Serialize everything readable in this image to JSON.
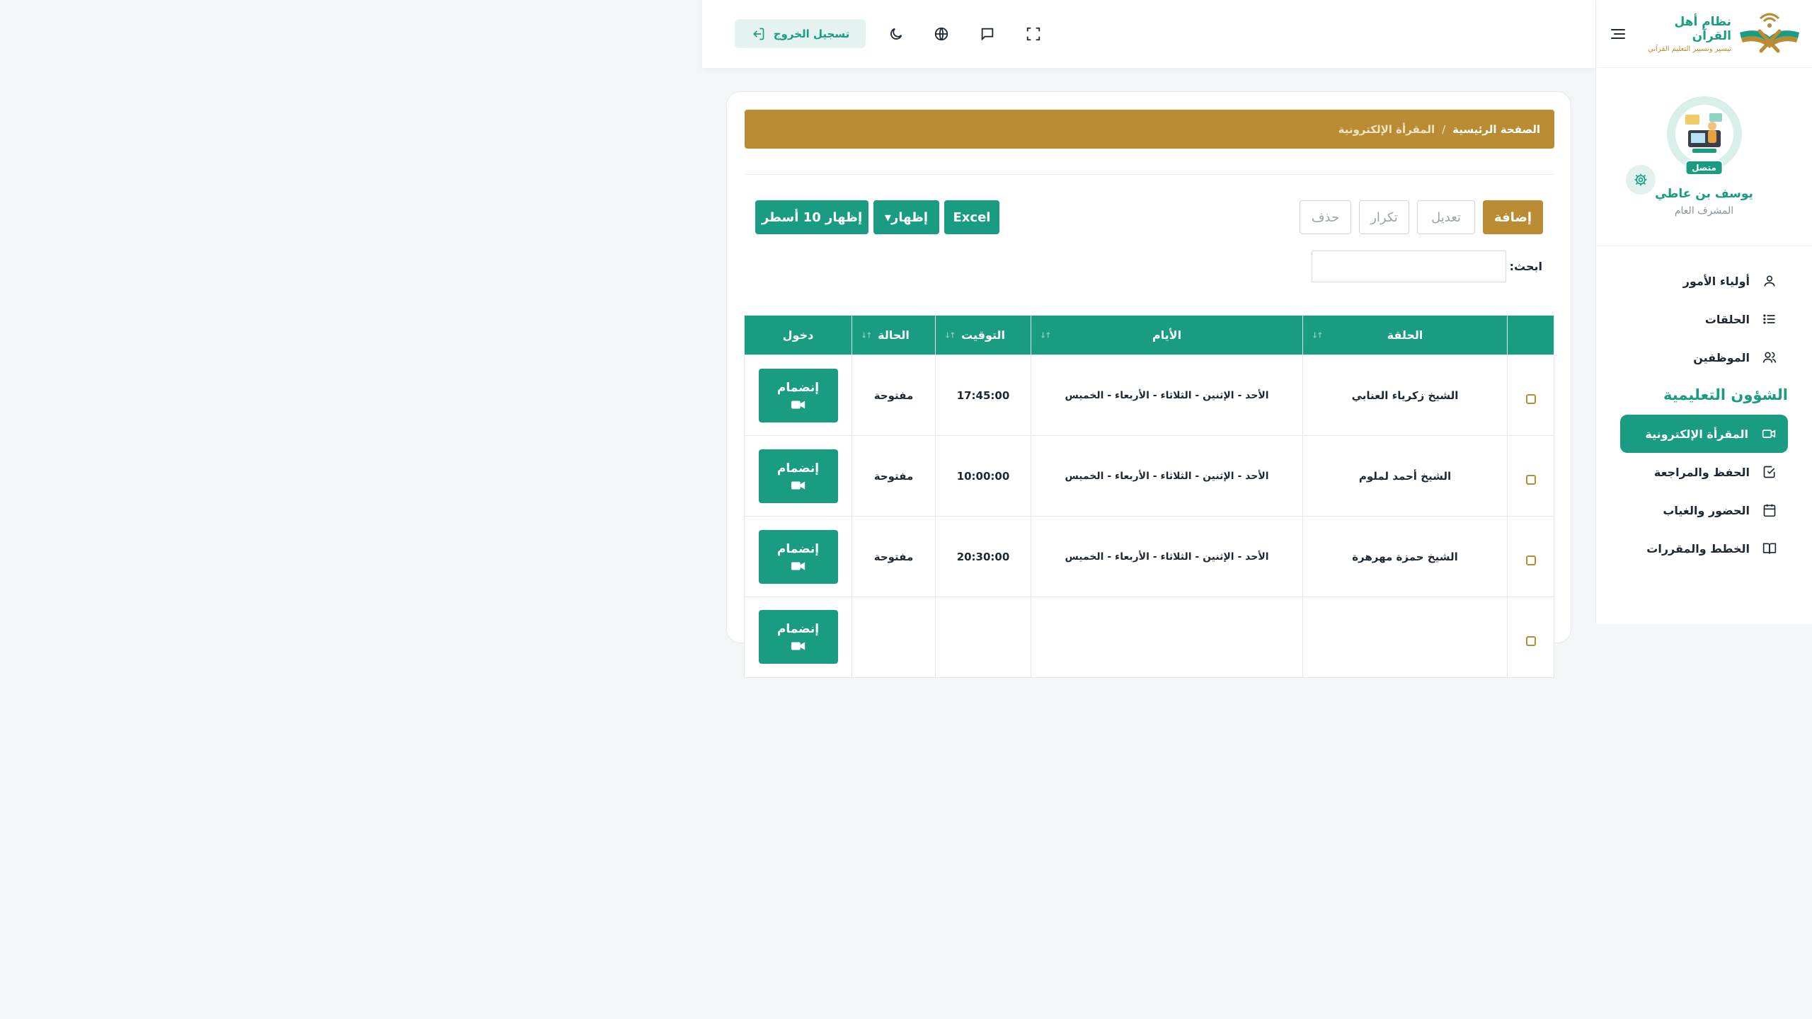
{
  "brand": {
    "title": "نظام أهل القرآن",
    "subtitle": "تيسير وتسيير التعليم القرآني"
  },
  "profile": {
    "status": "متصل",
    "name": "يوسف بن عاطي",
    "role": "المشرف العام"
  },
  "sidebar": {
    "items": [
      {
        "label": "أولياء الأمور",
        "icon": "user-icon"
      },
      {
        "label": "الحلقات",
        "icon": "list-icon"
      },
      {
        "label": "الموظفين",
        "icon": "users-icon"
      }
    ],
    "section_title": "الشؤون التعليمية",
    "section_items": [
      {
        "label": "المقرأة الإلكترونية",
        "icon": "video-icon",
        "active": true
      },
      {
        "label": "الحفظ والمراجعة",
        "icon": "check-square-icon"
      },
      {
        "label": "الحضور والغياب",
        "icon": "calendar-icon"
      },
      {
        "label": "الخطط والمقررات",
        "icon": "book-icon"
      }
    ]
  },
  "topbar": {
    "logout_label": "تسجيل الخروج",
    "icons": [
      "moon-icon",
      "globe-icon",
      "chat-icon",
      "fullscreen-icon"
    ]
  },
  "breadcrumb": {
    "home": "الصفحة الرئيسية",
    "separator": "/",
    "current": "المقرأة الإلكترونية"
  },
  "toolbar": {
    "add": "إضافة",
    "edit": "تعديل",
    "duplicate": "تكرار",
    "delete": "حذف",
    "excel": "Excel",
    "show": "إظهار▾",
    "show_rows": "إظهار 10 أسطر"
  },
  "search": {
    "label": "ابحث:",
    "value": ""
  },
  "table": {
    "headers": {
      "circle": "الحلقة",
      "days": "الأيام",
      "time": "التوقيت",
      "status": "الحالة",
      "enter": "دخول"
    },
    "rows": [
      {
        "circle": "الشيخ زكرياء العنابي",
        "days": "الأحد - الإثنين - الثلاثاء - الأربعاء - الخميس",
        "time": "17:45:00",
        "status": "مفتوحة",
        "action": "إنضمام"
      },
      {
        "circle": "الشيخ أحمد لملوم",
        "days": "الأحد - الإثنين - الثلاثاء - الأربعاء - الخميس",
        "time": "10:00:00",
        "status": "مفتوحة",
        "action": "إنضمام"
      },
      {
        "circle": "الشيخ حمزة مهرهرة",
        "days": "الأحد - الإثنين - الثلاثاء - الأربعاء - الخميس",
        "time": "20:30:00",
        "status": "مفتوحة",
        "action": "إنضمام"
      },
      {
        "circle": "",
        "days": "",
        "time": "",
        "status": "",
        "action": "إنضمام"
      }
    ]
  },
  "colors": {
    "primary": "#1a9c82",
    "gold": "#b98c33",
    "background": "#f3f5f8"
  }
}
